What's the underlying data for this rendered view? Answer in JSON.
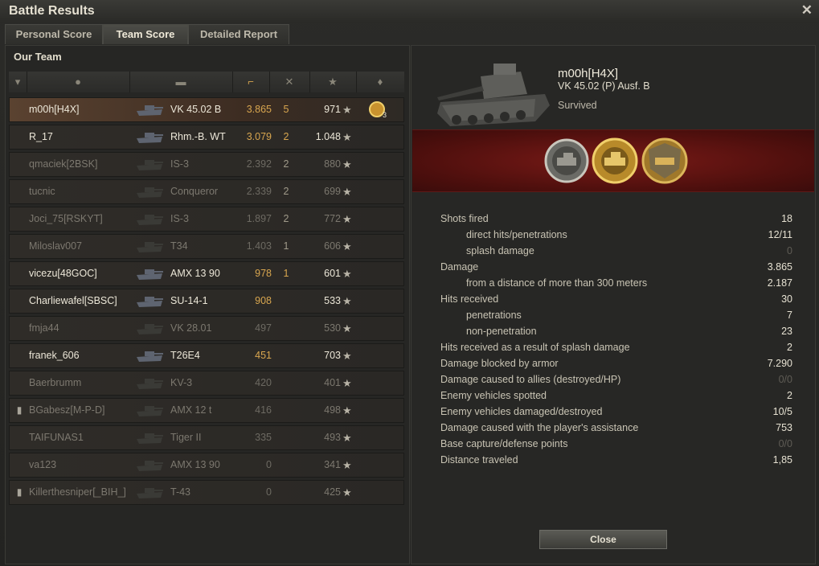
{
  "window": {
    "title": "Battle Results"
  },
  "tabs": [
    {
      "label": "Personal Score"
    },
    {
      "label": "Team Score"
    },
    {
      "label": "Detailed Report"
    }
  ],
  "team": {
    "title": "Our Team",
    "rows": [
      {
        "name": "m00h[H4X]",
        "vehicle": "VK 45.02 B",
        "damage": "3.865",
        "kills": "5",
        "xp": "971",
        "medal_count": "3",
        "alive": true,
        "selected": true,
        "damage_highlight": true
      },
      {
        "name": "R_17",
        "vehicle": "Rhm.-B. WT",
        "damage": "3.079",
        "kills": "2",
        "xp": "1.048",
        "alive": true,
        "damage_highlight": true
      },
      {
        "name": "qmaciek[2BSK]",
        "vehicle": "IS-3",
        "damage": "2.392",
        "kills": "2",
        "xp": "880",
        "alive": false
      },
      {
        "name": "tucnic",
        "vehicle": "Conqueror",
        "damage": "2.339",
        "kills": "2",
        "xp": "699",
        "alive": false
      },
      {
        "name": "Joci_75[RSKYT]",
        "vehicle": "IS-3",
        "damage": "1.897",
        "kills": "2",
        "xp": "772",
        "alive": false
      },
      {
        "name": "Miloslav007",
        "vehicle": "T34",
        "damage": "1.403",
        "kills": "1",
        "xp": "606",
        "alive": false
      },
      {
        "name": "vicezu[48GOC]",
        "vehicle": "AMX 13 90",
        "damage": "978",
        "kills": "1",
        "xp": "601",
        "alive": true,
        "damage_highlight": true
      },
      {
        "name": "Charliewafel[SBSC]",
        "vehicle": "SU-14-1",
        "damage": "908",
        "kills": "",
        "xp": "533",
        "alive": true,
        "damage_highlight": true
      },
      {
        "name": "fmja44",
        "vehicle": "VK 28.01",
        "damage": "497",
        "kills": "",
        "xp": "530",
        "alive": false
      },
      {
        "name": "franek_606",
        "vehicle": "T26E4",
        "damage": "451",
        "kills": "",
        "xp": "703",
        "alive": true,
        "damage_highlight": true
      },
      {
        "name": "Baerbrumm",
        "vehicle": "KV-3",
        "damage": "420",
        "kills": "",
        "xp": "401",
        "alive": false
      },
      {
        "name": "BGabesz[M-P-D]",
        "vehicle": "AMX 12 t",
        "damage": "416",
        "kills": "",
        "xp": "498",
        "alive": false,
        "platoon": true
      },
      {
        "name": "TAIFUNAS1",
        "vehicle": "Tiger II",
        "damage": "335",
        "kills": "",
        "xp": "493",
        "alive": false
      },
      {
        "name": "va123",
        "vehicle": "AMX 13 90",
        "damage": "0",
        "kills": "",
        "xp": "341",
        "alive": false
      },
      {
        "name": "Killerthesniper[_BIH_]",
        "vehicle": "T-43",
        "damage": "0",
        "kills": "",
        "xp": "425",
        "alive": false,
        "platoon": true
      }
    ]
  },
  "player": {
    "name": "m00h[H4X]",
    "vehicle": "VK 45.02 (P) Ausf. B",
    "status": "Survived"
  },
  "stats": [
    {
      "label": "Shots fired",
      "value": "18",
      "sub": false
    },
    {
      "label": "direct hits/penetrations",
      "value": "12/11",
      "sub": true
    },
    {
      "label": "splash damage",
      "value": "0",
      "sub": true,
      "zero": true
    },
    {
      "label": "Damage",
      "value": "3.865",
      "sub": false
    },
    {
      "label": "from a distance of more than 300 meters",
      "value": "2.187",
      "sub": true
    },
    {
      "label": "Hits received",
      "value": "30",
      "sub": false
    },
    {
      "label": "penetrations",
      "value": "7",
      "sub": true
    },
    {
      "label": "non-penetration",
      "value": "23",
      "sub": true
    },
    {
      "label": "Hits received as a result of splash damage",
      "value": "2",
      "sub": false
    },
    {
      "label": "Damage blocked by armor",
      "value": "7.290",
      "sub": false
    },
    {
      "label": "Damage caused to allies (destroyed/HP)",
      "value": "0/0",
      "sub": false,
      "zero": true
    },
    {
      "label": "Enemy vehicles spotted",
      "value": "2",
      "sub": false
    },
    {
      "label": "Enemy vehicles damaged/destroyed",
      "value": "10/5",
      "sub": false
    },
    {
      "label": "Damage caused with the player's assistance",
      "value": "753",
      "sub": false
    },
    {
      "label": "Base capture/defense points",
      "value": "0/0",
      "sub": false,
      "zero": true
    },
    {
      "label": "Distance traveled",
      "value": "1,85",
      "sub": false
    }
  ],
  "buttons": {
    "close": "Close"
  },
  "icons": {
    "header": [
      "platoon-icon",
      "player-icon",
      "tank-icon",
      "damage-icon",
      "kills-icon",
      "xp-star-icon",
      "medal-icon"
    ],
    "medals": [
      "medal-kolobanov-icon",
      "medal-ace-tanker-icon",
      "medal-defender-icon"
    ]
  },
  "colors": {
    "accent": "#d8a64f",
    "medal_band": "#6a1714",
    "selected_row": "#5a4230"
  }
}
